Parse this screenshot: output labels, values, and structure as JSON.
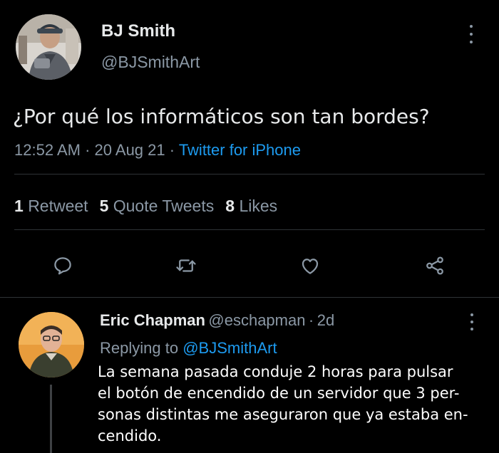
{
  "tweet": {
    "author_name": "BJ Smith",
    "author_handle": "@BJSmithArt",
    "text": "¿Por qué los informáticos son tan bordes?",
    "time": "12:52 AM",
    "date": "20 Aug 21",
    "source": "Twitter for iPhone",
    "separator": "·"
  },
  "stats": {
    "retweets_count": "1",
    "retweets_label": "Retweet",
    "quotes_count": "5",
    "quotes_label": "Quote Tweets",
    "likes_count": "8",
    "likes_label": "Likes"
  },
  "actions": {
    "reply_icon": "reply-icon",
    "retweet_icon": "retweet-icon",
    "like_icon": "heart-icon",
    "share_icon": "share-icon"
  },
  "reply": {
    "author_name": "Eric Chapman",
    "author_handle": "@eschapman",
    "separator": "·",
    "age": "2d",
    "replying_prefix": "Replying to",
    "replying_to": "@BJSmithArt",
    "lines": [
      "La semana pasada conduje 2 horas para pulsar",
      "el botón de encendido de un servidor que 3 per-",
      "sonas distintas me aseguraron que ya estaba en-",
      "cendido."
    ]
  },
  "colors": {
    "background": "#000000",
    "text": "#e7e9ea",
    "muted": "#8b98a5",
    "accent": "#1d9bf0",
    "divider": "#2f3336"
  }
}
